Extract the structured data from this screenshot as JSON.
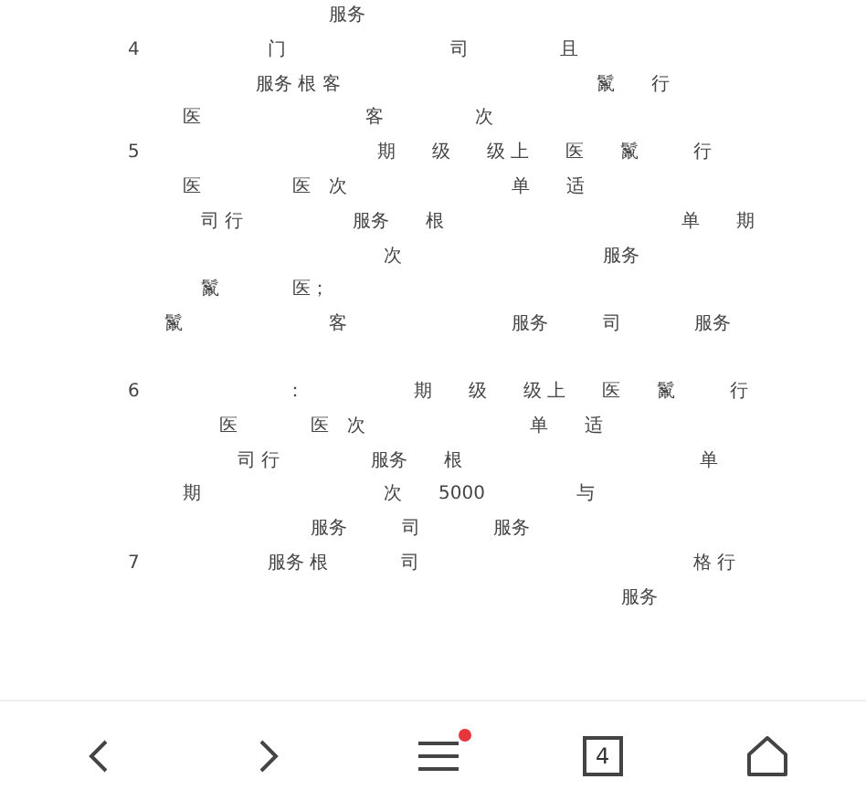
{
  "page": {
    "blocks": [
      {
        "lines": [
          "　　　　　　　　　　　　　　　　　　服务",
          "　　　　　　　4　　　　　　　门　　　　　　　　　司　　　　　且",
          "　　　　　　　　　　　　　　服务 根 客　　　　　　　　　　　　　　鬣　　行",
          "　　　　　　　　　　医　　　　　　　　　客　　　　　次",
          "　　　　　　　5　　　　　　　　　　　　　期　　级　　级 上　　医　　鬣　　　行",
          "　　　　　　　　　　医　　　　　医　次　　　　　　　　　单　　适",
          "　　　　　　　　　　　司 行　　　　　　服务　　根　　　　　　　　　　　　　单　　期",
          "　　　　　　　　　　　　　　　　　　　　　次　　　　　　　　　　　服务",
          "　　　　　　　　　　　鬣　　　　医；",
          "　　　　　　　　　鬣　　　　　　　　客　　　　　　　　　服务　　　司　　　　服务"
        ]
      },
      {
        "lines": [
          "　　　　　　　6　　　　　　　　：　　　　　　期　　级　　级 上　　医　　鬣　　　行",
          "　　　　　　　　　　　　医　　　　医　次　　　　　　　　　单　　适",
          "　　　　　　　　　　　　　司 行　　　　　服务　　根　　　　　　　　　　　　　单",
          "　　　　　　　　　　期　　　　　　　　　　次　　5000　　　　　与",
          "　　　　　　　　　　　　　　　　　服务　　　司　　　　服务",
          "　　　　　　　7　　　　　　　服务 根　　　　司　　　　　　　　　　　　　　　格 行",
          "　　　　　　　　　　　　　　　　　　　　　　　　　　　　　　　　　　服务"
        ]
      }
    ]
  },
  "toolbar": {
    "menu_notification": true,
    "tab_count": "4"
  }
}
